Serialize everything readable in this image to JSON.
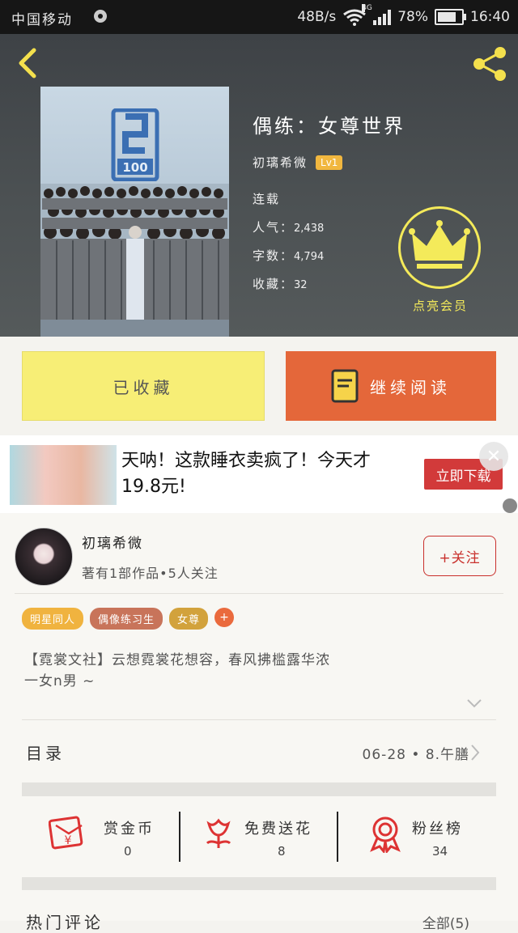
{
  "status": {
    "carrier": "中国移动",
    "speed": "48B/s",
    "network": "4G",
    "battery": "78%",
    "time": "16:40"
  },
  "book": {
    "title": "偶练：女尊世界",
    "author": "初璃希微",
    "level": "Lv1",
    "state": "连载",
    "popularity_label": "人气：",
    "popularity": "2,438",
    "words_label": "字数：",
    "words": "4,794",
    "favorites_label": "收藏：",
    "favorites": "32",
    "cover_badge": "100"
  },
  "vip": {
    "label": "点亮会员"
  },
  "actions": {
    "favorited": "已收藏",
    "continue": "继续阅读"
  },
  "ad": {
    "text": "天呐！这款睡衣卖疯了！今天才19.8元!",
    "button": "立即下载",
    "close": "✕"
  },
  "author_card": {
    "name": "初璃希微",
    "stats": "著有1部作品•5人关注",
    "follow": "+关注"
  },
  "tags": [
    {
      "label": "明星同人",
      "color": "#f0b33f"
    },
    {
      "label": "偶像练习生",
      "color": "#c8745a"
    },
    {
      "label": "女尊",
      "color": "#d2a23c"
    }
  ],
  "tag_add": "+",
  "description": "【霓裳文社】云想霓裳花想容，春风拂槛露华浓\n一女n男 ~",
  "toc": {
    "label": "目录",
    "latest": "06-28 • 8.午膳"
  },
  "stats": [
    {
      "label": "赏金币",
      "value": "0",
      "icon": "red-envelope-icon"
    },
    {
      "label": "免费送花",
      "value": "8",
      "icon": "flower-icon"
    },
    {
      "label": "粉丝榜",
      "value": "34",
      "icon": "medal-icon"
    }
  ],
  "comments": {
    "label": "热门评论",
    "all": "全部(5)"
  }
}
